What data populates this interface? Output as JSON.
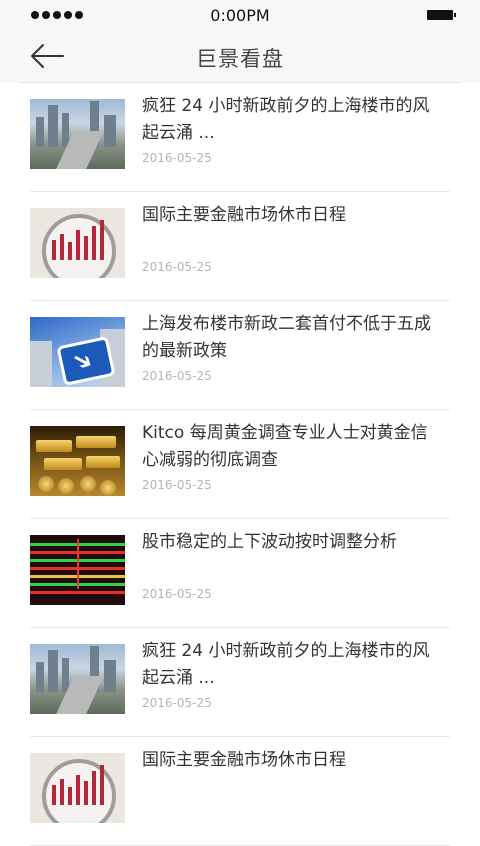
{
  "status": {
    "time": "0:00PM"
  },
  "nav": {
    "title": "巨景看盘"
  },
  "items": [
    {
      "title": "疯狂 24 小时新政前夕的上海楼市的风起云涌 ...",
      "date": "2016-05-25",
      "thumb": "city"
    },
    {
      "title": "国际主要金融市场休市日程",
      "date": "2016-05-25",
      "thumb": "chart"
    },
    {
      "title": "上海发布楼市新政二套首付不低于五成的最新政策",
      "date": "2016-05-25",
      "thumb": "sign"
    },
    {
      "title": "Kitco 每周黄金调查专业人士对黄金信心减弱的彻底调查",
      "date": "2016-05-25",
      "thumb": "gold"
    },
    {
      "title": "股市稳定的上下波动按时调整分析",
      "date": "2016-05-25",
      "thumb": "board"
    },
    {
      "title": "疯狂 24 小时新政前夕的上海楼市的风起云涌 ...",
      "date": "2016-05-25",
      "thumb": "city"
    },
    {
      "title": "国际主要金融市场休市日程",
      "date": "",
      "thumb": "chart"
    }
  ]
}
